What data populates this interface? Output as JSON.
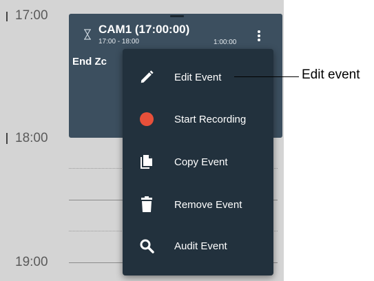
{
  "calendar": {
    "times": [
      "17:00",
      "18:00",
      "19:00"
    ]
  },
  "event": {
    "title": "CAM1 (17:00:00)",
    "time_range": "17:00 - 18:00",
    "duration": "1:00:00",
    "description": "End Zc",
    "icons": [
      "hourglass-icon",
      "kebab-menu-icon"
    ]
  },
  "menu": {
    "items": [
      {
        "label": "Edit Event",
        "icon": "pencil-icon"
      },
      {
        "label": "Start Recording",
        "icon": "record-icon",
        "icon_color": "#e8503a"
      },
      {
        "label": "Copy Event",
        "icon": "copy-icon"
      },
      {
        "label": "Remove Event",
        "icon": "trash-icon"
      },
      {
        "label": "Audit Event",
        "icon": "search-icon"
      }
    ]
  },
  "callout": {
    "label": "Edit event"
  },
  "colors": {
    "event_bg": "#3c4f5f",
    "menu_bg": "#22313d",
    "calendar_bg": "#d4d4d4"
  }
}
